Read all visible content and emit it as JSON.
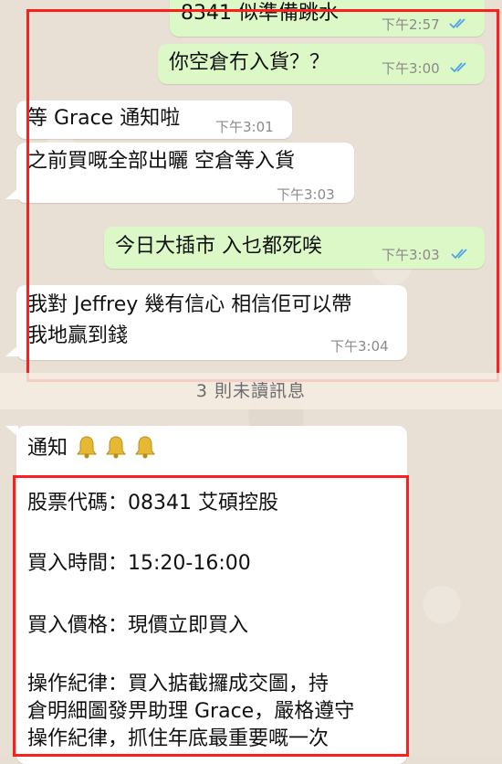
{
  "colors": {
    "outgoing_bubble": "#dcf8c6",
    "incoming_bubble": "#ffffff",
    "read_ticks": "#4fa4e8",
    "highlight_box": "#ff1e1e",
    "wallpaper": "#e9e0d5"
  },
  "messages": [
    {
      "dir": "out",
      "text": "8341 似準備跳水",
      "time": "下午2:57",
      "status": "read"
    },
    {
      "dir": "out",
      "text": "你空倉冇入貨？？",
      "time": "下午3:00",
      "status": "read"
    },
    {
      "dir": "in",
      "text": "等 Grace 通知啦",
      "time": "下午3:01"
    },
    {
      "dir": "in",
      "text": "之前買嘅全部出曬  空倉等入貨",
      "time": "下午3:03"
    },
    {
      "dir": "out",
      "text": "今日大插市 入乜都死唉",
      "time": "下午3:03",
      "status": "read"
    },
    {
      "dir": "in",
      "lines": [
        "我對 Jeffrey 幾有信心  相信佢可以帶",
        "我地贏到錢"
      ],
      "time": "下午3:04"
    }
  ],
  "unread_divider": "3 則未讀訊息",
  "notice": {
    "title": "通知",
    "bell_icon": "bell-icon",
    "lines": [
      "股票代碼：08341  艾碩控股",
      "買入時間：15:20-16:00",
      "買入價格：現價立即買入",
      "操作紀律：買入掂截攞成交圖，持",
      "倉明細圖發畀助理 Grace，嚴格遵守",
      "操作紀律，抓住年底最重要嘅一次"
    ]
  }
}
